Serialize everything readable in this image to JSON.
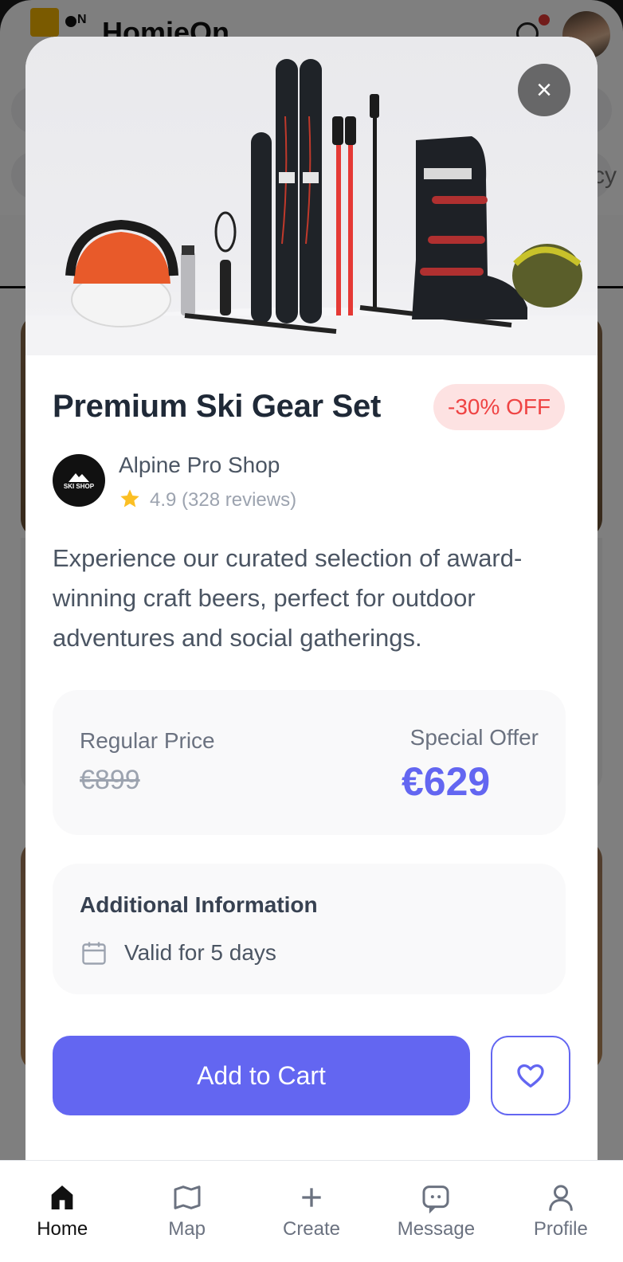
{
  "background": {
    "app_title": "HomieOn",
    "logo_mark": "N",
    "search_placeholder_partial": "cy"
  },
  "product": {
    "title": "Premium Ski Gear Set",
    "discount_badge": "-30% OFF",
    "shop_name": "Alpine Pro Shop",
    "shop_logo_text": "SKI SHOP",
    "rating": "4.9 (328 reviews)",
    "description": "Experience our curated selection of award-winning craft beers, perfect for outdoor adventures and social gatherings.",
    "hero_image": "ski-gear-photo"
  },
  "pricing": {
    "regular_label": "Regular Price",
    "regular_price": "€899",
    "special_label": "Special Offer",
    "special_price": "€629"
  },
  "info": {
    "title": "Additional Information",
    "validity": "Valid for 5 days"
  },
  "actions": {
    "add_to_cart": "Add to Cart",
    "close_symbol": "×"
  },
  "nav": {
    "items": [
      {
        "label": "Home",
        "icon": "home-icon",
        "active": true
      },
      {
        "label": "Map",
        "icon": "map-icon",
        "active": false
      },
      {
        "label": "Create",
        "icon": "plus-icon",
        "active": false
      },
      {
        "label": "Message",
        "icon": "message-icon",
        "active": false
      },
      {
        "label": "Profile",
        "icon": "profile-icon",
        "active": false
      }
    ]
  },
  "colors": {
    "accent": "#6366f1",
    "discount_bg": "#fde2e2",
    "discount_text": "#ef4444",
    "star": "#fbbf24"
  }
}
